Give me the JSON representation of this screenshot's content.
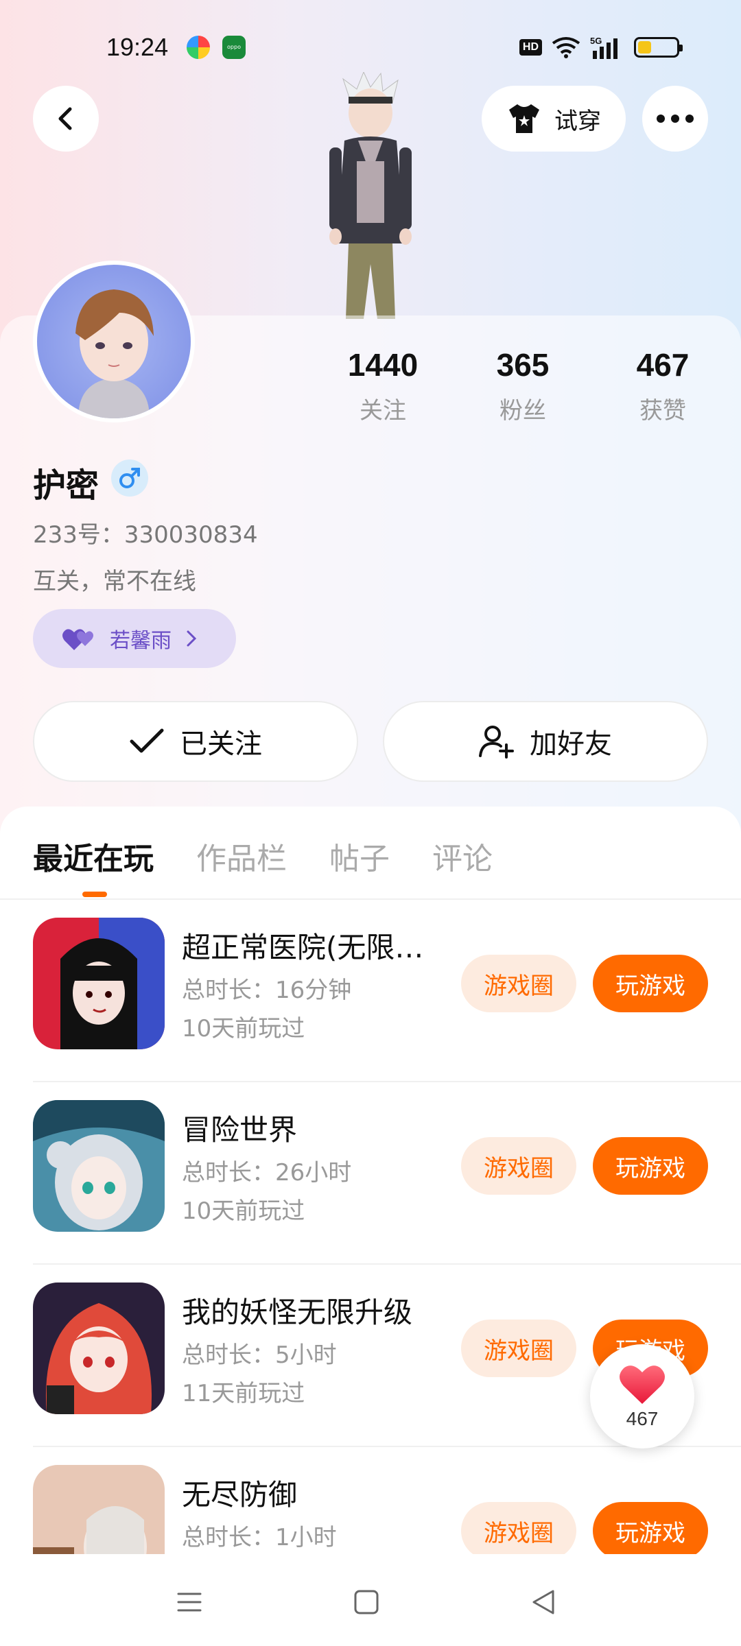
{
  "status_bar": {
    "time": "19:24",
    "hd": "HD",
    "network": "5G",
    "battery_level": 0.35
  },
  "header": {
    "tryon_label": "试穿"
  },
  "profile": {
    "name": "护密",
    "gender": "male",
    "uid": "233号：330030834",
    "bio": "互关，常不在线",
    "cp_name": "若馨雨"
  },
  "stats": [
    {
      "value": "1440",
      "label": "关注"
    },
    {
      "value": "365",
      "label": "粉丝"
    },
    {
      "value": "467",
      "label": "获赞"
    }
  ],
  "actions": {
    "following_label": "已关注",
    "add_friend_label": "加好友"
  },
  "tabs": [
    {
      "label": "最近在玩",
      "active": true
    },
    {
      "label": "作品栏",
      "active": false
    },
    {
      "label": "帖子",
      "active": false
    },
    {
      "label": "评论",
      "active": false
    }
  ],
  "games": [
    {
      "name": "超正常医院(无限恐...",
      "duration": "总时长：16分钟",
      "last_played": "10天前玩过",
      "circle_label": "游戏圈",
      "play_label": "玩游戏"
    },
    {
      "name": "冒险世界",
      "duration": "总时长：26小时",
      "last_played": "10天前玩过",
      "circle_label": "游戏圈",
      "play_label": "玩游戏"
    },
    {
      "name": "我的妖怪无限升级",
      "duration": "总时长：5小时",
      "last_played": "11天前玩过",
      "circle_label": "游戏圈",
      "play_label": "玩游戏"
    },
    {
      "name": "无尽防御",
      "duration": "总时长：1小时",
      "last_played": "",
      "circle_label": "游戏圈",
      "play_label": "玩游戏"
    }
  ],
  "like_float": {
    "count": "467"
  },
  "colors": {
    "accent": "#ff6a00",
    "accent_light": "#fdebdf",
    "cp_purple": "#6b4fc7"
  }
}
